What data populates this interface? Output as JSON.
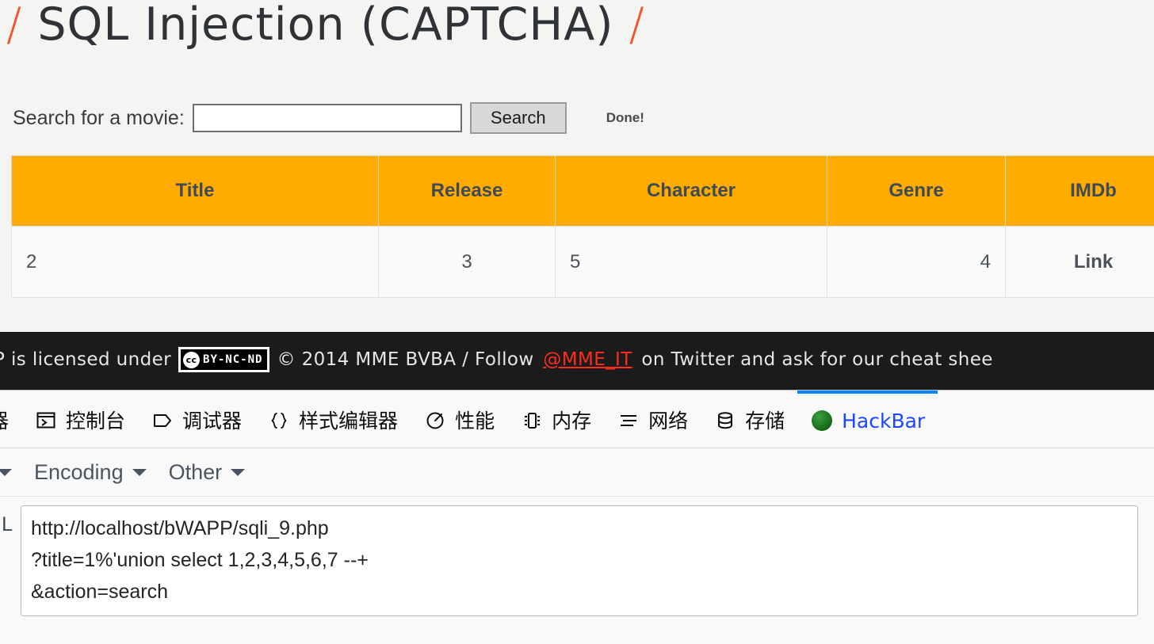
{
  "page": {
    "title_prefix_slash": "/",
    "title": "SQL Injection (CAPTCHA)",
    "title_suffix_slash": "/"
  },
  "search": {
    "label": "Search for a movie:",
    "input_value": "",
    "placeholder": "",
    "button_label": "Search",
    "status": "Done!"
  },
  "results": {
    "columns": [
      "Title",
      "Release",
      "Character",
      "Genre",
      "IMDb"
    ],
    "rows": [
      {
        "title": "2",
        "release": "3",
        "character": "5",
        "genre": "4",
        "imdb": "Link"
      }
    ]
  },
  "footer": {
    "text_before_badge": "P is licensed under",
    "cc_mark": "cc",
    "cc_license": "BY-NC-ND",
    "text_after_badge": "© 2014 MME BVBA / Follow",
    "twitter_handle": "@MME_IT",
    "text_tail": "on Twitter and ask for our cheat shee"
  },
  "devtools": {
    "tabs": [
      {
        "label": "器",
        "icon": "inspector-icon",
        "active": false,
        "partial": true
      },
      {
        "label": "控制台",
        "icon": "console-icon",
        "active": false
      },
      {
        "label": "调试器",
        "icon": "debugger-icon",
        "active": false
      },
      {
        "label": "样式编辑器",
        "icon": "style-editor-icon",
        "active": false
      },
      {
        "label": "性能",
        "icon": "performance-icon",
        "active": false
      },
      {
        "label": "内存",
        "icon": "memory-icon",
        "active": false
      },
      {
        "label": "网络",
        "icon": "network-icon",
        "active": false
      },
      {
        "label": "存储",
        "icon": "storage-icon",
        "active": false
      },
      {
        "label": "HackBar",
        "icon": "hackbar-icon",
        "active": true
      }
    ]
  },
  "hackbar": {
    "menus": [
      "Encoding",
      "Other"
    ],
    "url_label": "L",
    "side_marker": "-",
    "url_value": "http://localhost/bWAPP/sqli_9.php\n?title=1%'union select 1,2,3,4,5,6,7 --+\n&action=search"
  },
  "colors": {
    "accent_orange": "#ffab00",
    "title_slash": "#f4512c",
    "footer_bg": "#1b1b1b",
    "link_red": "#ff2d1a",
    "active_tab_blue": "#0a84ff",
    "hackbar_blue": "#1a47ff"
  }
}
